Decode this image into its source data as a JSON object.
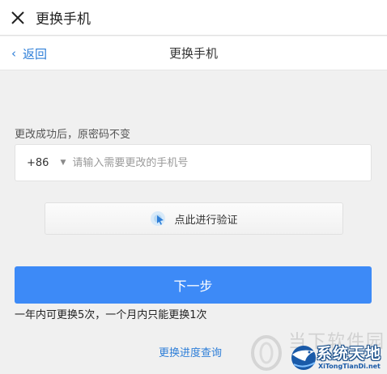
{
  "window": {
    "title": "更换手机"
  },
  "nav": {
    "back_label": "返回",
    "title": "更换手机"
  },
  "form": {
    "hint": "更改成功后，原密码不变",
    "country_code": "+86",
    "phone_placeholder": "请输入需要更改的手机号",
    "phone_value": ""
  },
  "verify": {
    "label": "点此进行验证"
  },
  "next_button": {
    "label": "下一步"
  },
  "limit_note": "一年内可更换5次，一个月内只能更换1次",
  "progress_link": "更换进度查询",
  "watermark": {
    "ghost_text": "当下软件园",
    "main_text": "系统天地",
    "url": "XiTongTianDi.net"
  },
  "colors": {
    "primary": "#3d8af7",
    "link": "#2f7fd8",
    "background": "#f0f0f0"
  },
  "icons": {
    "close": "close-icon",
    "back": "chevron-left-icon",
    "dropdown": "caret-down-icon",
    "verify": "cursor-click-icon"
  }
}
